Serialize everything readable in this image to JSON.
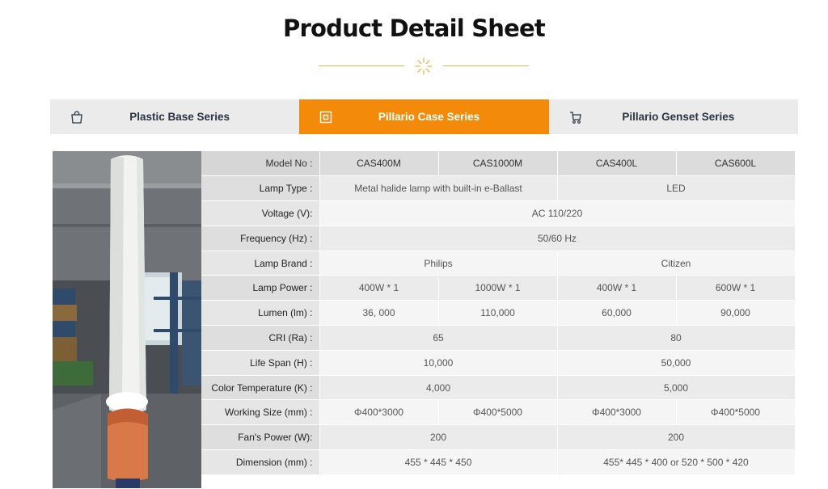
{
  "page": {
    "title": "Product Detail Sheet"
  },
  "tabs": [
    {
      "label": "Plastic Base Series",
      "icon": "shopping-bag-icon",
      "active": false
    },
    {
      "label": "Pillario Case Series",
      "icon": "square-target-icon",
      "active": true
    },
    {
      "label": "Pillario Genset Series",
      "icon": "cart-icon",
      "active": false
    }
  ],
  "colors": {
    "accent": "#f38a0a",
    "divider": "#e8b84a"
  },
  "photo": {
    "icon": "product-light-tower-image"
  },
  "table": {
    "rows": [
      {
        "label": "Model No :",
        "cells": [
          {
            "text": "CAS400M",
            "span": 1
          },
          {
            "text": "CAS1000M",
            "span": 1
          },
          {
            "text": "CAS400L",
            "span": 1
          },
          {
            "text": "CAS600L",
            "span": 1
          }
        ]
      },
      {
        "label": "Lamp Type :",
        "cells": [
          {
            "text": "Metal halide lamp with built-in e-Ballast",
            "span": 2
          },
          {
            "text": "LED",
            "span": 2
          }
        ]
      },
      {
        "label": "Voltage (V):",
        "cells": [
          {
            "text": "AC 110/220",
            "span": 4
          }
        ]
      },
      {
        "label": "Frequency (Hz) :",
        "cells": [
          {
            "text": "50/60 Hz",
            "span": 4
          }
        ]
      },
      {
        "label": "Lamp Brand :",
        "cells": [
          {
            "text": "Philips",
            "span": 2
          },
          {
            "text": "Citizen",
            "span": 2
          }
        ]
      },
      {
        "label": "Lamp Power :",
        "cells": [
          {
            "text": "400W * 1",
            "span": 1
          },
          {
            "text": "1000W * 1",
            "span": 1
          },
          {
            "text": "400W * 1",
            "span": 1
          },
          {
            "text": "600W * 1",
            "span": 1
          }
        ]
      },
      {
        "label": "Lumen (lm) :",
        "cells": [
          {
            "text": "36, 000",
            "span": 1
          },
          {
            "text": "110,000",
            "span": 1
          },
          {
            "text": "60,000",
            "span": 1
          },
          {
            "text": "90,000",
            "span": 1
          }
        ]
      },
      {
        "label": "CRI (Ra) :",
        "cells": [
          {
            "text": "65",
            "span": 2
          },
          {
            "text": "80",
            "span": 2
          }
        ]
      },
      {
        "label": "Life Span (H) :",
        "cells": [
          {
            "text": "10,000",
            "span": 2
          },
          {
            "text": "50,000",
            "span": 2
          }
        ]
      },
      {
        "label": "Color Temperature (K) :",
        "cells": [
          {
            "text": "4,000",
            "span": 2
          },
          {
            "text": "5,000",
            "span": 2
          }
        ]
      },
      {
        "label": "Working Size (mm) :",
        "cells": [
          {
            "text": "Φ400*3000",
            "span": 1
          },
          {
            "text": "Φ400*5000",
            "span": 1
          },
          {
            "text": "Φ400*3000",
            "span": 1
          },
          {
            "text": "Φ400*5000",
            "span": 1
          }
        ]
      },
      {
        "label": "Fan's Power (W):",
        "cells": [
          {
            "text": "200",
            "span": 2
          },
          {
            "text": "200",
            "span": 2
          }
        ]
      },
      {
        "label": "Dimension (mm) :",
        "cells": [
          {
            "text": "455 * 445 * 450",
            "span": 2
          },
          {
            "text": "455* 445 * 400 or 520 * 500 * 420",
            "span": 2
          }
        ]
      }
    ]
  }
}
